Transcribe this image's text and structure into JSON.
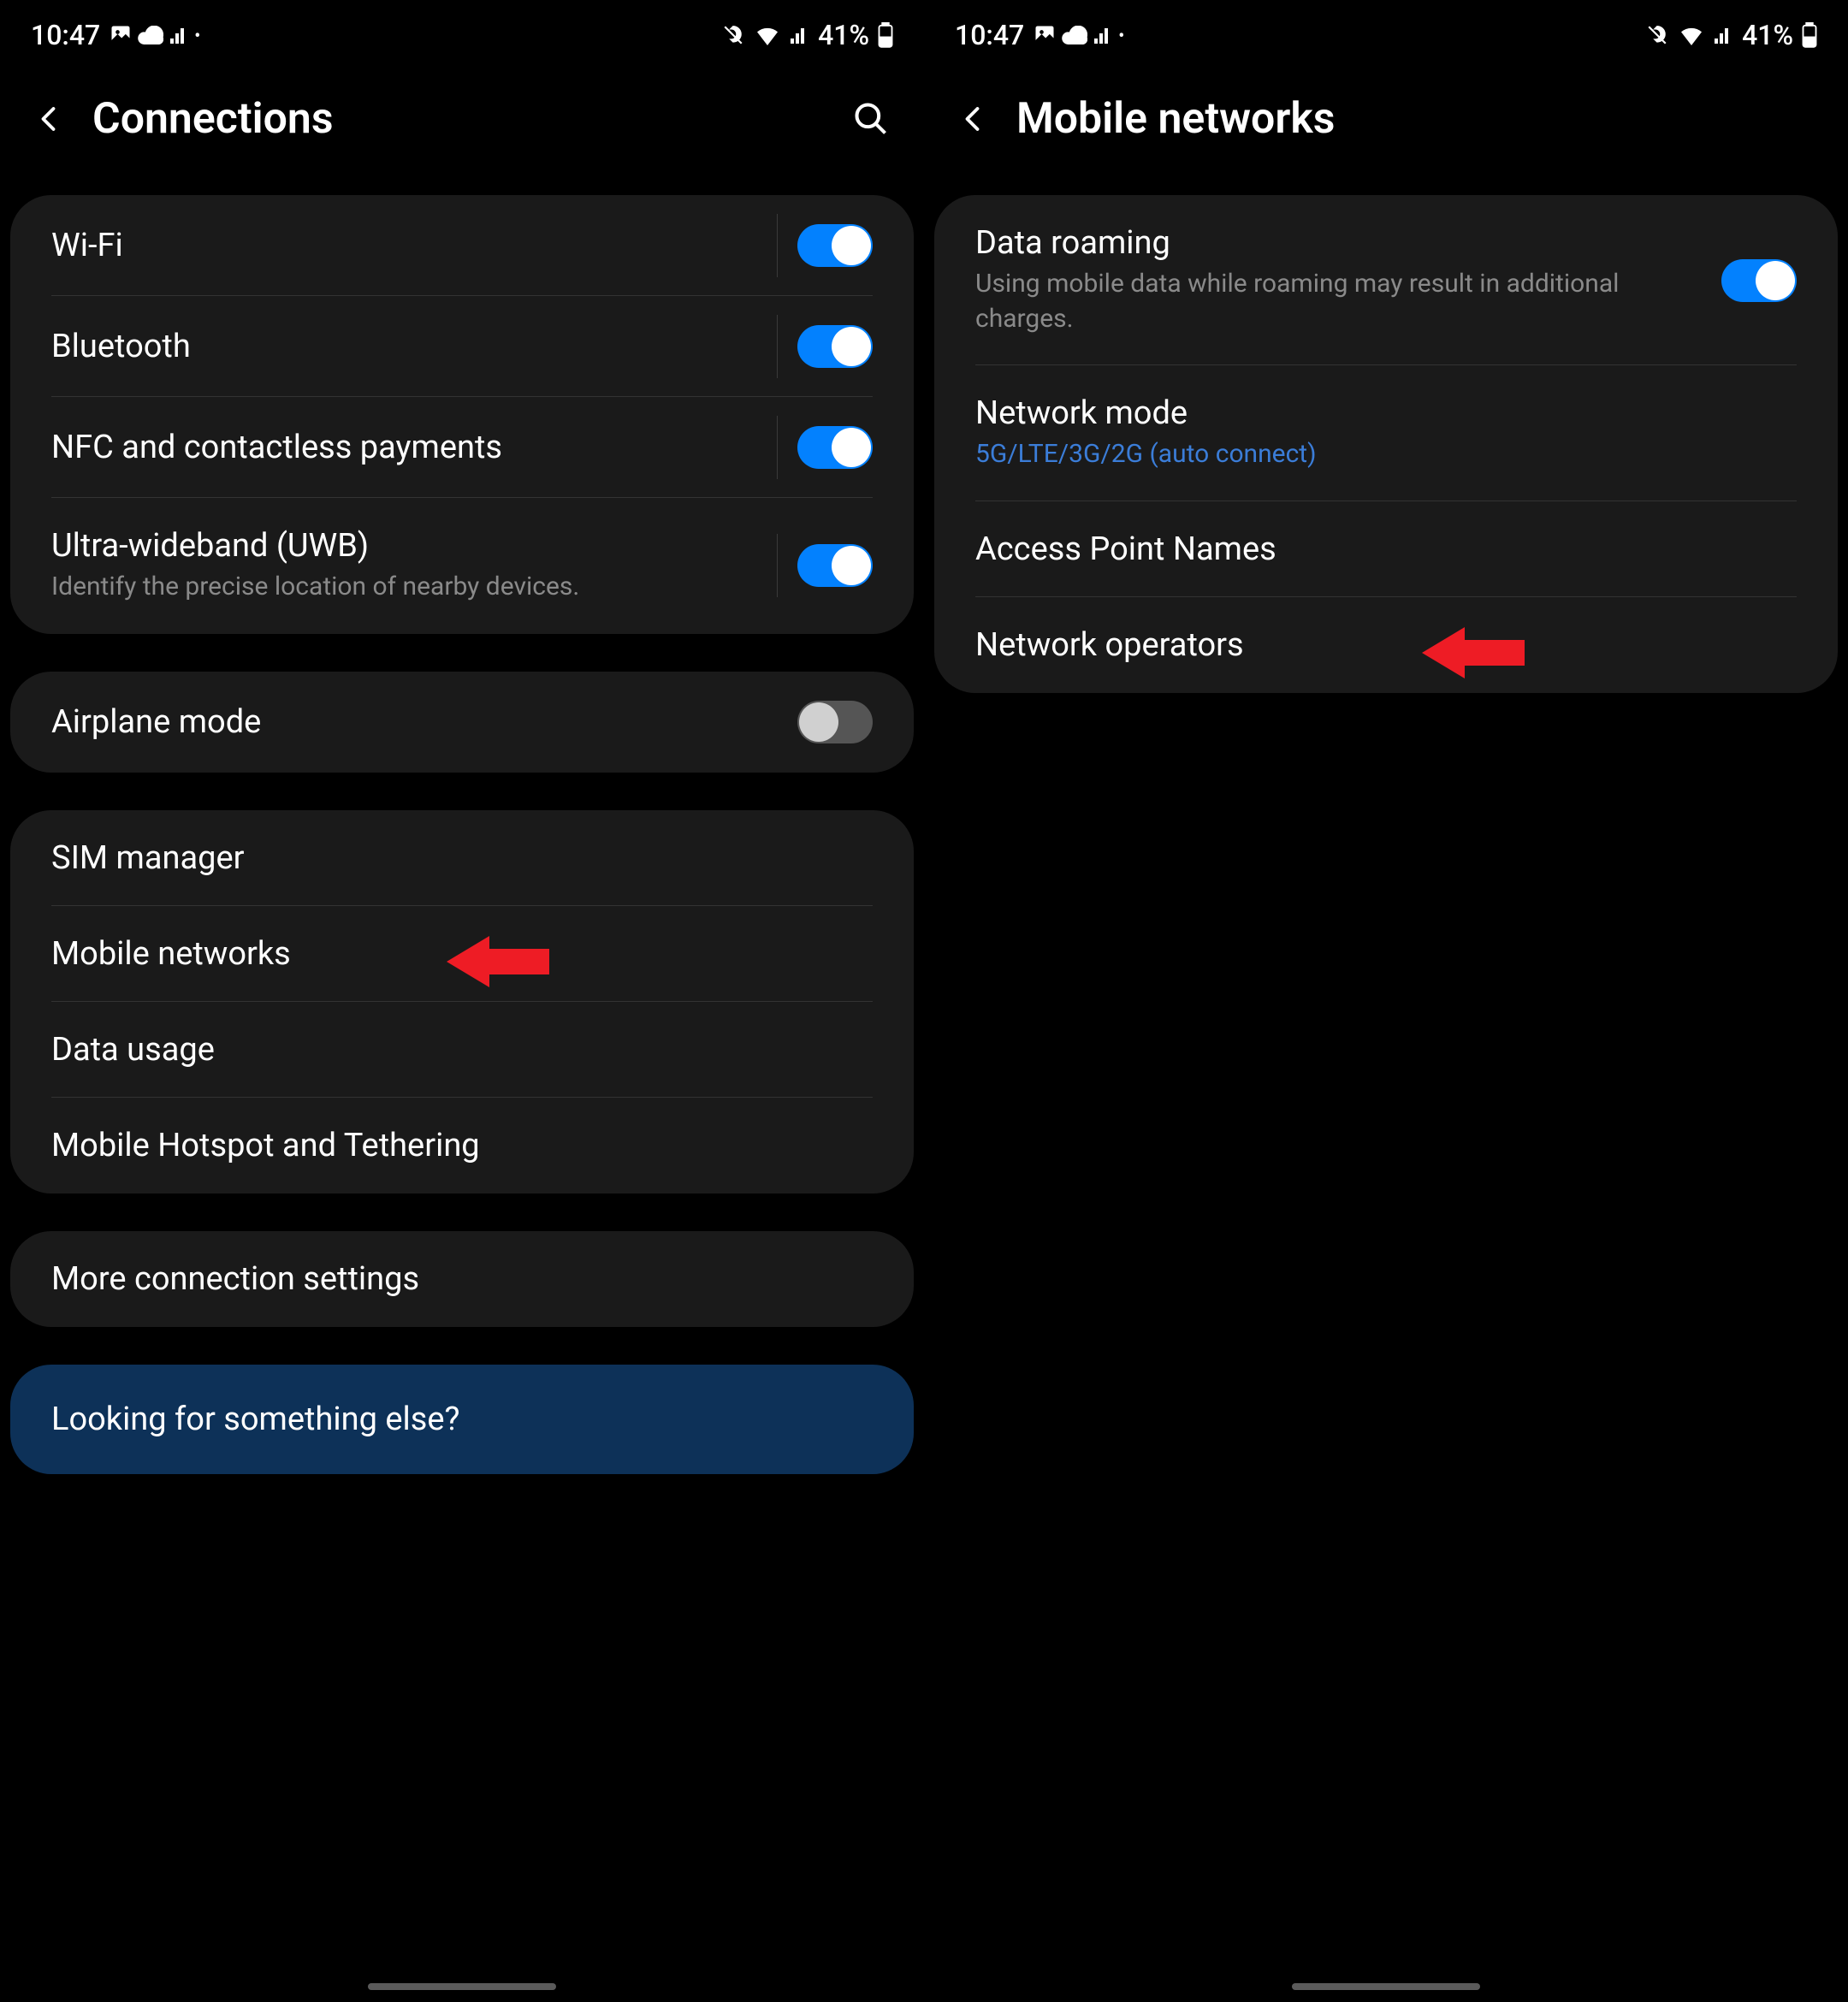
{
  "status": {
    "time": "10:47",
    "battery_pct": "41%"
  },
  "screens": [
    {
      "title": "Connections",
      "has_search": true,
      "groups": [
        {
          "items": [
            {
              "name": "wifi",
              "title": "Wi-Fi",
              "toggle": true,
              "toggle_on": true,
              "divider": true,
              "toggle_divider": true
            },
            {
              "name": "bluetooth",
              "title": "Bluetooth",
              "toggle": true,
              "toggle_on": true,
              "divider": true,
              "toggle_divider": true
            },
            {
              "name": "nfc",
              "title": "NFC and contactless payments",
              "toggle": true,
              "toggle_on": true,
              "divider": true,
              "toggle_divider": true
            },
            {
              "name": "uwb",
              "title": "Ultra-wideband (UWB)",
              "sub": "Identify the precise location of nearby devices.",
              "toggle": true,
              "toggle_on": true
            }
          ]
        },
        {
          "items": [
            {
              "name": "airplane",
              "title": "Airplane mode",
              "toggle": true,
              "toggle_on": false
            }
          ]
        },
        {
          "items": [
            {
              "name": "sim",
              "title": "SIM manager",
              "divider": true
            },
            {
              "name": "mobile-networks",
              "title": "Mobile networks",
              "divider": true,
              "arrow": true
            },
            {
              "name": "data-usage",
              "title": "Data usage",
              "divider": true
            },
            {
              "name": "hotspot",
              "title": "Mobile Hotspot and Tethering"
            }
          ]
        },
        {
          "items": [
            {
              "name": "more",
              "title": "More connection settings"
            }
          ]
        }
      ],
      "help": "Looking for something else?"
    },
    {
      "title": "Mobile networks",
      "has_search": false,
      "groups": [
        {
          "items": [
            {
              "name": "roaming",
              "title": "Data roaming",
              "sub": "Using mobile data while roaming may result in additional charges.",
              "toggle": true,
              "toggle_on": true,
              "divider": true
            },
            {
              "name": "network-mode",
              "title": "Network mode",
              "sub": "5G/LTE/3G/2G (auto connect)",
              "sub_link": true,
              "divider": true
            },
            {
              "name": "apn",
              "title": "Access Point Names",
              "divider": true
            },
            {
              "name": "operators",
              "title": "Network operators",
              "arrow": true
            }
          ]
        }
      ]
    }
  ]
}
